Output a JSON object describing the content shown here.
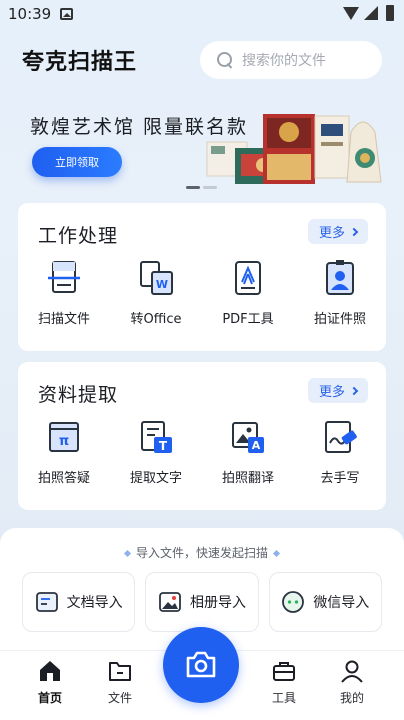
{
  "status_bar": {
    "time": "10:39"
  },
  "header": {
    "app_title": "夸克扫描王",
    "search_placeholder": "搜索你的文件"
  },
  "banner": {
    "title": "敦煌艺术馆 限量联名款",
    "button": "立即领取"
  },
  "work": {
    "title": "工作处理",
    "more": "更多",
    "tools": [
      {
        "label": "扫描文件",
        "icon": "scan-document-icon"
      },
      {
        "label": "转Office",
        "icon": "convert-office-icon"
      },
      {
        "label": "PDF工具",
        "icon": "pdf-tool-icon"
      },
      {
        "label": "拍证件照",
        "icon": "id-photo-icon"
      }
    ]
  },
  "extract": {
    "title": "资料提取",
    "more": "更多",
    "tools": [
      {
        "label": "拍照答疑",
        "icon": "photo-question-icon"
      },
      {
        "label": "提取文字",
        "icon": "extract-text-icon"
      },
      {
        "label": "拍照翻译",
        "icon": "photo-translate-icon"
      },
      {
        "label": "去手写",
        "icon": "remove-handwriting-icon"
      }
    ]
  },
  "import": {
    "hint": "导入文件，快速发起扫描",
    "buttons": [
      {
        "label": "文档导入",
        "icon": "document-import-icon"
      },
      {
        "label": "相册导入",
        "icon": "album-import-icon"
      },
      {
        "label": "微信导入",
        "icon": "wechat-import-icon"
      }
    ]
  },
  "nav": {
    "items": [
      {
        "label": "首页",
        "icon": "home-icon",
        "active": true
      },
      {
        "label": "文件",
        "icon": "folder-icon",
        "active": false
      },
      {
        "label": "工具",
        "icon": "toolbox-icon",
        "active": false
      },
      {
        "label": "我的",
        "icon": "profile-icon",
        "active": false
      }
    ],
    "camera_icon": "camera-icon"
  },
  "colors": {
    "accent": "#2060F0",
    "accent_light": "#E6EEFC",
    "background": "#E4EEF8"
  }
}
